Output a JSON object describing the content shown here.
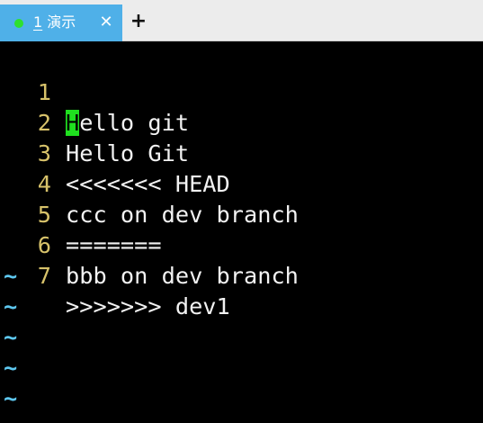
{
  "tabbar": {
    "tab": {
      "number": "1",
      "title": "演示",
      "close_symbol": "✕",
      "status_color": "#2ee02e",
      "active_color": "#4fb0e8"
    },
    "new_tab_symbol": "+"
  },
  "editor": {
    "cursor": {
      "line": 1,
      "column": 1,
      "char": "H",
      "rest": "ello git"
    },
    "lines": [
      {
        "num": "1",
        "text": "Hello git"
      },
      {
        "num": "2",
        "text": "Hello Git"
      },
      {
        "num": "3",
        "text": "<<<<<<< HEAD"
      },
      {
        "num": "4",
        "text": "ccc on dev branch"
      },
      {
        "num": "5",
        "text": "======="
      },
      {
        "num": "6",
        "text": "bbb on dev branch"
      },
      {
        "num": "7",
        "text": ">>>>>>> dev1"
      }
    ],
    "empty_line_marker": "~",
    "empty_line_count": 5,
    "colors": {
      "line_number": "#d7c26a",
      "text": "#f2f2f2",
      "cursor": "#1fe01f",
      "tilde": "#5ec8f0"
    }
  }
}
